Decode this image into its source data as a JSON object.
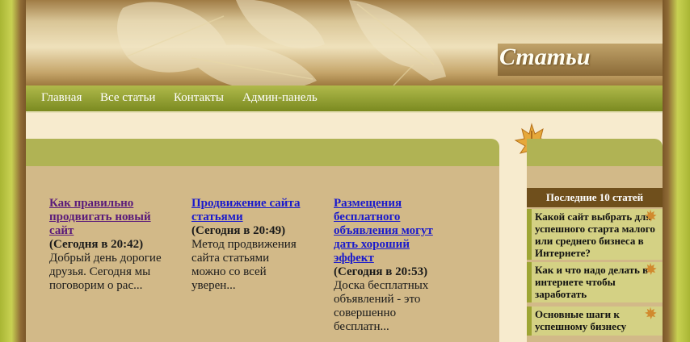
{
  "header": {
    "title": "Статьи"
  },
  "nav": {
    "items": [
      {
        "label": "Главная"
      },
      {
        "label": "Все статьи"
      },
      {
        "label": "Контакты"
      },
      {
        "label": "Админ-панель"
      }
    ]
  },
  "articles": [
    {
      "title": "Как правильно продвигать новый сайт",
      "date": "(Сегодня в 20:42)",
      "excerpt": "Добрый день дорогие друзья. Сегодня мы поговорим о рас..."
    },
    {
      "title": "Продвижение сайта статьями",
      "date": "(Сегодня в 20:49)",
      "excerpt": "Метод продвижения сайта статьями можно со всей уверен..."
    },
    {
      "title": "Размещения бесплатного объявления могут дать хороший эффект",
      "date": "(Сегодня в 20:53)",
      "excerpt": "Доска бесплатных объявлений - это совершенно бесплатн..."
    }
  ],
  "sidebar": {
    "title": "Последние 10 статей",
    "items": [
      {
        "label": "Какой сайт выбрать для успешного старта малого или среднего бизнеса в Интернете?"
      },
      {
        "label": "Как и что надо делать в интернете чтобы заработать"
      },
      {
        "label": "Основные шаги к успешному бизнесу"
      }
    ]
  },
  "colors": {
    "accent": "#95a236",
    "content_bg": "#d2b988",
    "sidebar_title_bg": "#6f4f1c",
    "link": "#1a1acc",
    "visited_link": "#5a1a7a"
  },
  "icons": [
    "autumn-leaf-icon"
  ]
}
